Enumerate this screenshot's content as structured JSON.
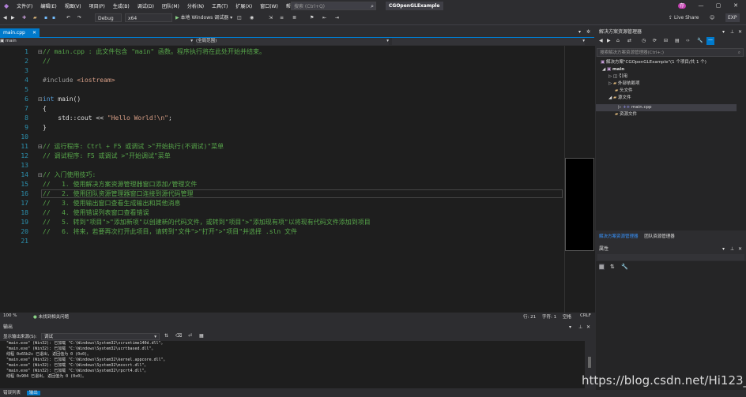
{
  "menu": [
    "文件(F)",
    "编辑(E)",
    "视图(V)",
    "项目(P)",
    "生成(B)",
    "调试(D)",
    "团队(M)",
    "分析(N)",
    "工具(T)",
    "扩展(X)",
    "窗口(W)",
    "帮助(H)"
  ],
  "search_placeholder": "搜索 (Ctrl+Q)",
  "app_title": "CGOpenGLExample",
  "live_share": "Live Share",
  "exp_badge": "EXP",
  "user_avatar": "存",
  "toolbar": {
    "config": "Debug",
    "platform": "x64",
    "run": "本地 Windows 调试器"
  },
  "editor_tab": "main.cpp",
  "nav_scope": "main",
  "nav_global": "(全局范围)",
  "code_lines": [
    {
      "n": "1",
      "segs": [
        {
          "c": "cm",
          "t": "// main.cpp : 此文件包含 \"main\" 函数。程序执行将在此处开始并结束。"
        }
      ]
    },
    {
      "n": "2",
      "segs": [
        {
          "c": "cm",
          "t": "//"
        }
      ]
    },
    {
      "n": "3",
      "segs": []
    },
    {
      "n": "4",
      "segs": [
        {
          "c": "pp",
          "t": "#include "
        },
        {
          "c": "st",
          "t": "<iostream>"
        }
      ]
    },
    {
      "n": "5",
      "segs": []
    },
    {
      "n": "6",
      "segs": [
        {
          "c": "kw",
          "t": "int"
        },
        {
          "c": "",
          "t": " main()"
        }
      ]
    },
    {
      "n": "7",
      "segs": [
        {
          "c": "",
          "t": "{"
        }
      ]
    },
    {
      "n": "8",
      "segs": [
        {
          "c": "",
          "t": "    std::cout << "
        },
        {
          "c": "st",
          "t": "\"Hello World!\\n\""
        },
        {
          "c": "",
          "t": ";"
        }
      ]
    },
    {
      "n": "9",
      "segs": [
        {
          "c": "",
          "t": "}"
        }
      ]
    },
    {
      "n": "10",
      "segs": []
    },
    {
      "n": "11",
      "segs": [
        {
          "c": "cm",
          "t": "// 运行程序: Ctrl + F5 或调试 >\"开始执行(不调试)\"菜单"
        }
      ]
    },
    {
      "n": "12",
      "segs": [
        {
          "c": "cm",
          "t": "// 调试程序: F5 或调试 >\"开始调试\"菜单"
        }
      ]
    },
    {
      "n": "13",
      "segs": []
    },
    {
      "n": "14",
      "segs": [
        {
          "c": "cm",
          "t": "// 入门使用技巧:"
        }
      ]
    },
    {
      "n": "15",
      "segs": [
        {
          "c": "cm",
          "t": "//   1. 使用解决方案资源管理器窗口添加/管理文件"
        }
      ]
    },
    {
      "n": "16",
      "segs": [
        {
          "c": "cm",
          "t": "//   2. 使用团队资源管理器窗口连接到源代码管理"
        }
      ]
    },
    {
      "n": "17",
      "segs": [
        {
          "c": "cm",
          "t": "//   3. 使用输出窗口查看生成输出和其他消息"
        }
      ]
    },
    {
      "n": "18",
      "segs": [
        {
          "c": "cm",
          "t": "//   4. 使用错误列表窗口查看错误"
        }
      ]
    },
    {
      "n": "19",
      "segs": [
        {
          "c": "cm",
          "t": "//   5. 转到\"项目\">\"添加新项\"以创建新的代码文件，或转到\"项目\">\"添加现有项\"以将现有代码文件添加到项目"
        }
      ]
    },
    {
      "n": "20",
      "segs": [
        {
          "c": "cm",
          "t": "//   6. 将来，若要再次打开此项目，请转到\"文件\">\"打开\">\"项目\"并选择 .sln 文件"
        }
      ]
    },
    {
      "n": "21",
      "segs": []
    }
  ],
  "edstatus": {
    "zoom": "100 %",
    "issues": "未找到相关问题",
    "row": "行: 21",
    "col": "字符: 1",
    "ins": "空格",
    "eol": "CRLF"
  },
  "output": {
    "title": "输出",
    "source_label": "显示输出来源(S):",
    "source_value": "调试",
    "lines": [
      "\"main.exe\" (Win32): 已加载 \"C:\\Windows\\System32\\vcruntime140d.dll\"。",
      "\"main.exe\" (Win32): 已加载 \"C:\\Windows\\System32\\ucrtbased.dll\"。",
      "线程 0x65b2c 已退出, 返回值为 0 (0x0)。",
      "\"main.exe\" (Win32): 已加载 \"C:\\Windows\\System32\\kernel.appcore.dll\"。",
      "\"main.exe\" (Win32): 已加载 \"C:\\Windows\\System32\\msvcrt.dll\"。",
      "\"main.exe\" (Win32): 已加载 \"C:\\Windows\\System32\\rpcrt4.dll\"。",
      "线程 0x904 已退出, 返回值为 0 (0x0)。"
    ]
  },
  "bottom_tabs": [
    "错误列表",
    "输出"
  ],
  "solution_explorer": {
    "title": "解决方案资源管理器",
    "search_placeholder": "搜索解决方案资源管理器(Ctrl+;)",
    "items": [
      {
        "label": "解决方案\"CGOpenGLExample\"(1 个项目/共 1 个)"
      },
      {
        "label": "main"
      },
      {
        "label": "引用"
      },
      {
        "label": "外部依赖项"
      },
      {
        "label": "头文件"
      },
      {
        "label": "源文件"
      },
      {
        "label": "main.cpp"
      },
      {
        "label": "资源文件"
      }
    ],
    "tabs": [
      "解决方案资源管理器",
      "团队资源管理器"
    ]
  },
  "properties": {
    "title": "属性"
  },
  "watermark": "https://blog.csdn.net/Hi123_"
}
